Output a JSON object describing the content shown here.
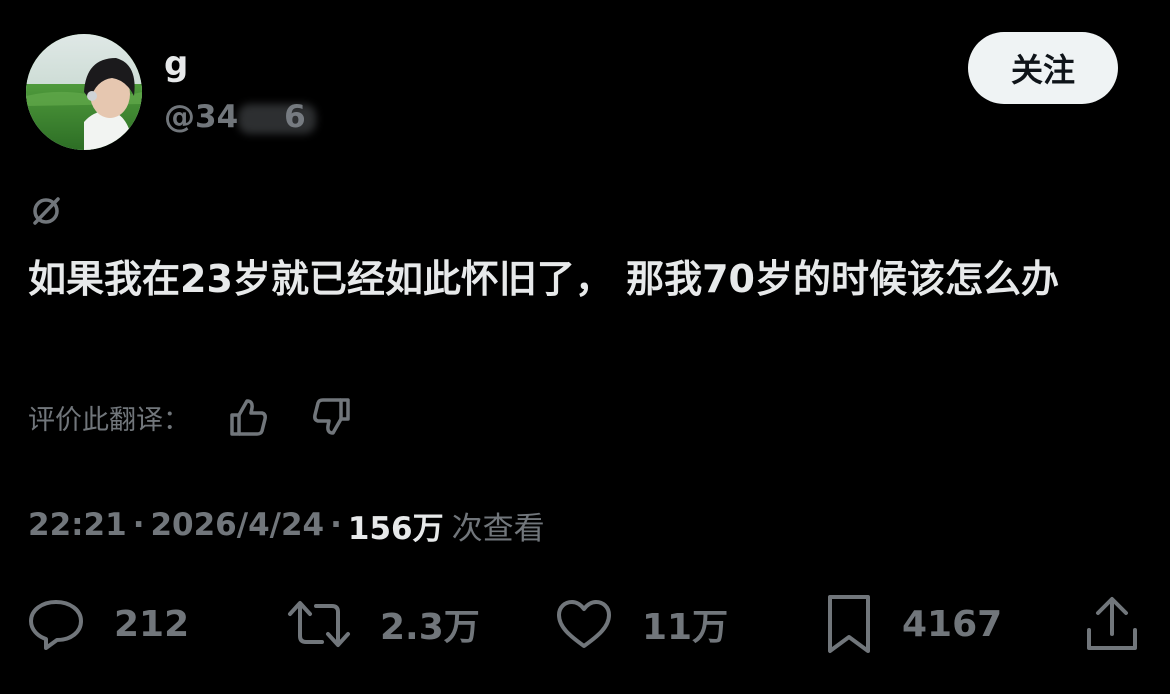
{
  "author": {
    "display_name": "g",
    "handle_visible": "@34",
    "handle_tail": "6"
  },
  "follow_label": "关注",
  "tweet_text": "如果我在23岁就已经如此怀旧了， 那我70岁的时候该怎么办",
  "rate": {
    "label": "评价此翻译："
  },
  "meta": {
    "time": "22:21",
    "date": "2026/4/24",
    "separator": "·",
    "views_count": "156万",
    "views_label": "次查看"
  },
  "actions": {
    "reply_count": "212",
    "retweet_count": "2.3万",
    "like_count": "11万",
    "bookmark_count": "4167"
  },
  "colors": {
    "background": "#000000",
    "primary_text": "#e7e9ea",
    "secondary_text": "#71767b",
    "follow_button_bg": "#eff3f4"
  },
  "icons": [
    "content-disclosure-icon",
    "thumbs-up-icon",
    "thumbs-down-icon",
    "reply-icon",
    "retweet-icon",
    "like-icon",
    "bookmark-icon",
    "share-icon"
  ]
}
